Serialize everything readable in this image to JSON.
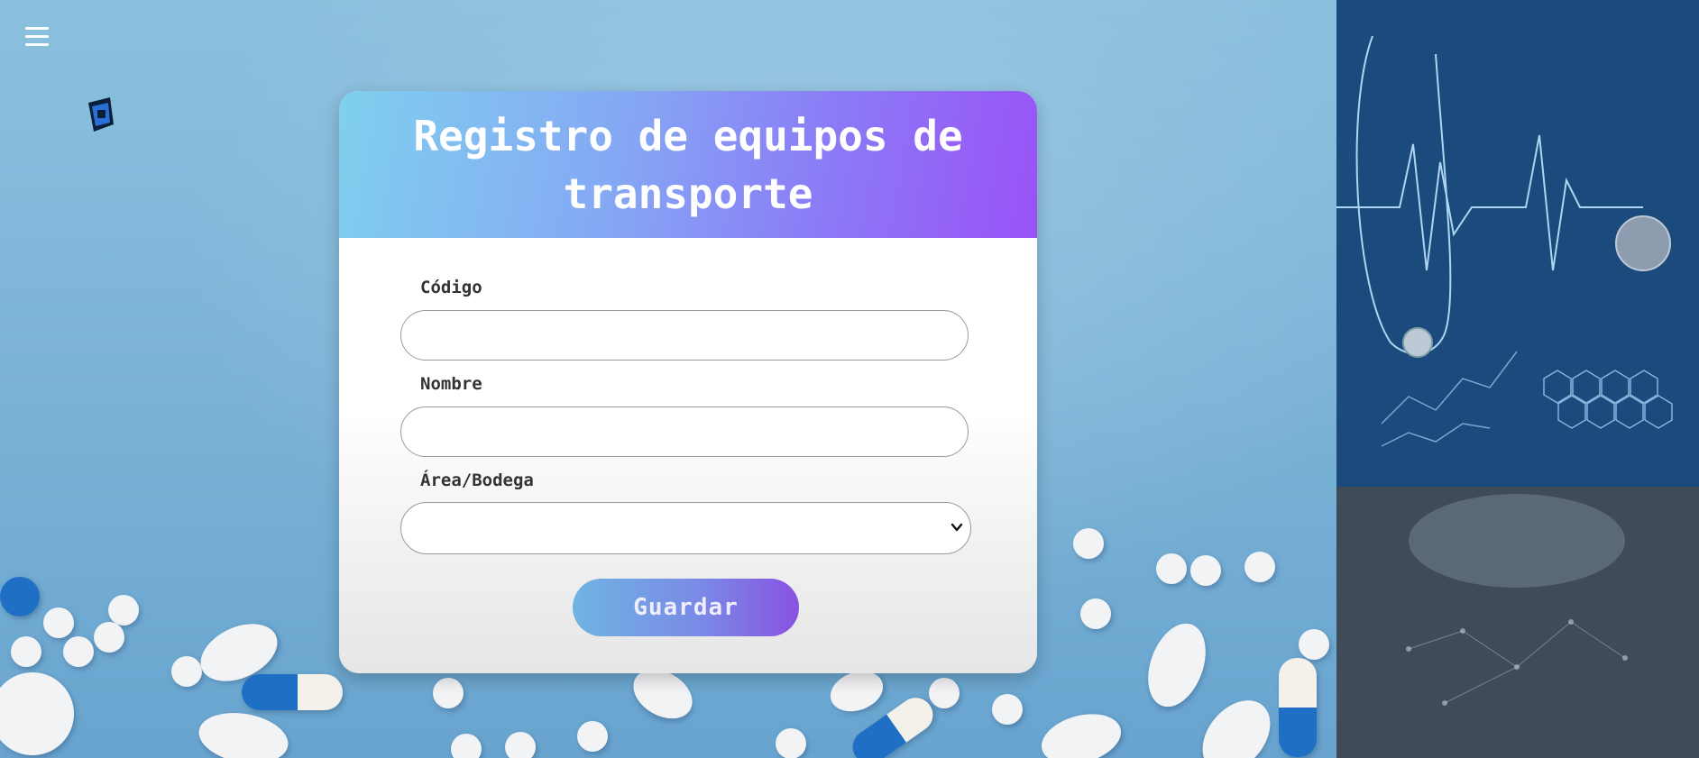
{
  "menu": {
    "icon": "hamburger-menu-icon"
  },
  "logo": {
    "icon": "app-logo-icon"
  },
  "form": {
    "title": "Registro de equipos de transporte",
    "fields": {
      "codigo": {
        "label": "Código",
        "value": ""
      },
      "nombre": {
        "label": "Nombre",
        "value": ""
      },
      "area": {
        "label": "Área/Bodega",
        "selected": ""
      }
    },
    "submit_label": "Guardar"
  },
  "colors": {
    "header_gradient_start": "#7fd0ee",
    "header_gradient_end": "#9a52f7",
    "button_gradient_start": "#6fb4e2",
    "button_gradient_end": "#8a52e3"
  }
}
